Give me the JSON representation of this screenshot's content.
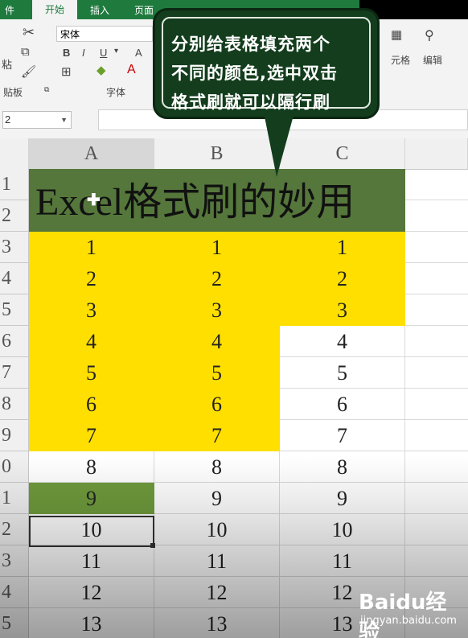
{
  "ribbon": {
    "tabs": [
      "件",
      "开始",
      "插入",
      "页面"
    ],
    "font_name": "宋体",
    "group_labels": [
      "贴板",
      "字体",
      "元格",
      "编辑"
    ],
    "bold": "B",
    "italic": "I",
    "underline": "U",
    "font_color_letter": "A"
  },
  "formula_bar": {
    "name_box": "2"
  },
  "callout": {
    "lines": [
      "分别给表格填充两个",
      "不同的颜色,选中双击",
      "格式刷就可以隔行刷"
    ]
  },
  "sheet": {
    "columns": [
      "A",
      "B",
      "C"
    ],
    "row_numbers": [
      "1",
      "2",
      "3",
      "4",
      "5",
      "6",
      "7",
      "8",
      "9",
      "0",
      "1",
      "2",
      "3",
      "4",
      "5"
    ],
    "title": "Excel格式刷的妙用",
    "rows": [
      {
        "a": "1",
        "b": "1",
        "c": "1"
      },
      {
        "a": "2",
        "b": "2",
        "c": "2"
      },
      {
        "a": "3",
        "b": "3",
        "c": "3"
      },
      {
        "a": "4",
        "b": "4",
        "c": "4"
      },
      {
        "a": "5",
        "b": "5",
        "c": "5"
      },
      {
        "a": "6",
        "b": "6",
        "c": "6"
      },
      {
        "a": "7",
        "b": "7",
        "c": "7"
      },
      {
        "a": "8",
        "b": "8",
        "c": "8"
      },
      {
        "a": "9",
        "b": "9",
        "c": "9"
      },
      {
        "a": "10",
        "b": "10",
        "c": "10"
      },
      {
        "a": "11",
        "b": "11",
        "c": "11"
      },
      {
        "a": "12",
        "b": "12",
        "c": "12"
      },
      {
        "a": "13",
        "b": "13",
        "c": "13"
      }
    ]
  },
  "colors": {
    "yellow_fill": "#ffdf00",
    "green_fill": "#6f9a3c",
    "title_fill": "#55773b",
    "callout_bg": "#133d1d"
  },
  "watermark": {
    "logo": "Baidu经验",
    "url": "jingyan.baidu.com"
  }
}
